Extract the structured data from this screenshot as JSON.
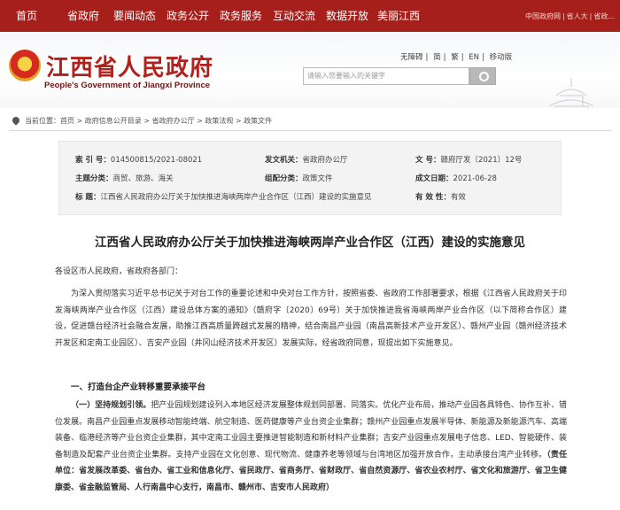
{
  "nav": {
    "items": [
      "首页",
      "省政府",
      "要闻动态",
      "政务公开",
      "政务服务",
      "互动交流",
      "数据开放",
      "美丽江西"
    ],
    "right": [
      "中国政府网",
      "省人大",
      "省政..."
    ],
    "right_sep": "|"
  },
  "header": {
    "title": "江西省人民政府",
    "subtitle": "People's Government of Jiangxi Province",
    "util": [
      "无障碍",
      "简",
      "繁",
      "EN",
      "移动版"
    ],
    "util_sep": "|",
    "search_placeholder": "请输入您要输入的关键字"
  },
  "breadcrumb": {
    "label": "当前位置：",
    "path": "首页 > 政府信息公开目录 > 省政府办公厅 > 政策法规 > 政策文件"
  },
  "meta": {
    "index_label": "索  引  号：",
    "index_value": "014500815/2021-08021",
    "agency_label": "发文机关：",
    "agency_value": "省政府办公厅",
    "doc_no_label": "文      号：",
    "doc_no_value": "赣府厅发〔2021〕12号",
    "topic_label": "主题分类：",
    "topic_value": "商贸、旅游、海关",
    "genre_label": "组配分类：",
    "genre_value": "政策文件",
    "date_label": "成文日期：",
    "date_value": "2021-06-28",
    "title_label": "标      题：",
    "title_value": "江西省人民政府办公厅关于加快推进海峡两岸产业合作区（江西）建设的实施意见",
    "validity_label": "有  效  性：",
    "validity_value": "有效"
  },
  "doc": {
    "title": "江西省人民政府办公厅关于加快推进海峡两岸产业合作区（江西）建设的实施意见",
    "salutation": "各设区市人民政府，省政府各部门：",
    "intro": "为深入贯彻落实习近平总书记关于对台工作的重要论述和中央对台工作方针，按照省委、省政府工作部署要求，根据《江西省人民政府关于印发海峡两岸产业合作区（江西）建设总体方案的通知》（赣府字〔2020〕69号）关于加快推进我省海峡两岸产业合作区（以下简称合作区）建设，促进赣台经济社会融合发展，助推江西高质量跨越式发展的精神，结合南昌产业园（南昌高新技术产业开发区）、赣州产业园（赣州经济技术开发区和定南工业园区）、吉安产业园（井冈山经济技术开发区）发展实际，经省政府同意，现提出如下实施意见。",
    "heading1": "一、打造台企产业转移重要承接平台",
    "p2_lead": "（一）坚持规划引领。",
    "p2_body": "把产业园规划建设列入本地区经济发展整体规划同部署、同落实。优化产业布局，推动产业园各具特色、协作互补、错位发展。南昌产业园重点发展移动智能终端、航空制造、医药健康等产业台资企业集群；赣州产业园重点发展半导体、新能源及新能源汽车、高端装备、临港经济等产业台资企业集群，其中定南工业园主要推进智能制造和新材料产业集群；吉安产业园重点发展电子信息、LED、智能硬件、装备制造及配套产业台资企业集群。支持产业园在文化创意、现代物流、健康养老等领域与台湾地区加强开放合作，主动承接台湾产业转移。",
    "p2_resp": "（责任单位：省发展改革委、省台办、省工业和信息化厅、省民政厅、省商务厅、省财政厅、省自然资源厅、省农业农村厅、省文化和旅游厅、省卫生健康委、省金融监管局、人行南昌中心支行，南昌市、赣州市、吉安市人民政府）"
  }
}
